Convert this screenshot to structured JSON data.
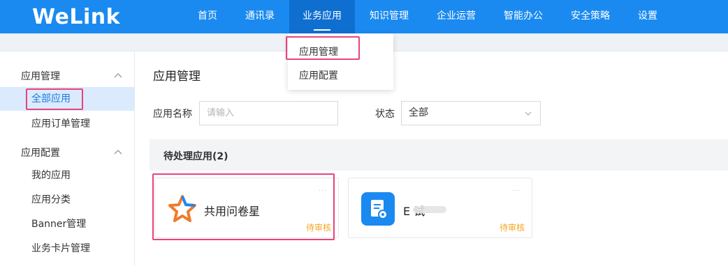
{
  "brand": {
    "logo_text": "WeLink"
  },
  "nav": {
    "items": [
      {
        "label": "首页"
      },
      {
        "label": "通讯录"
      },
      {
        "label": "业务应用"
      },
      {
        "label": "知识管理"
      },
      {
        "label": "企业运营"
      },
      {
        "label": "智能办公"
      },
      {
        "label": "安全策略"
      },
      {
        "label": "设置"
      }
    ],
    "active_index": 2
  },
  "dropdown": {
    "items": [
      {
        "label": "应用管理"
      },
      {
        "label": "应用配置"
      }
    ]
  },
  "sidebar": {
    "groups": [
      {
        "label": "应用管理",
        "items": [
          {
            "label": "全部应用"
          },
          {
            "label": "应用订单管理"
          }
        ]
      },
      {
        "label": "应用配置",
        "items": [
          {
            "label": "我的应用"
          },
          {
            "label": "应用分类"
          },
          {
            "label": "Banner管理"
          },
          {
            "label": "业务卡片管理"
          }
        ]
      }
    ],
    "active_item": "全部应用"
  },
  "main": {
    "title": "应用管理",
    "filters": {
      "name_label": "应用名称",
      "name_placeholder": "请输入",
      "status_label": "状态",
      "status_value": "全部"
    },
    "section_title": "待处理应用(2)",
    "cards": [
      {
        "name": "共用问卷星",
        "status": "待审核",
        "menu": "···"
      },
      {
        "name": "E      试",
        "status": "待审核",
        "menu": "···"
      }
    ]
  },
  "colors": {
    "topbar": "#1a8af0",
    "active_nav": "#0f6fd0",
    "sidebar_active_bg": "#dbeafc",
    "sidebar_active_text": "#1a7de0",
    "status_pending": "#f5a623",
    "highlight": "#e8437a"
  },
  "icons": {
    "card_0": "star-logo-icon",
    "card_1": "document-settings-icon"
  }
}
